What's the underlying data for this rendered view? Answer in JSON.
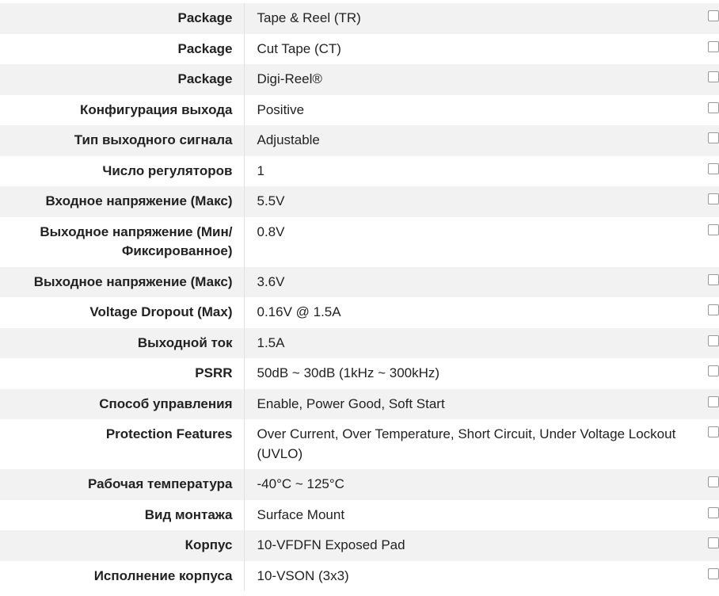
{
  "specs": [
    {
      "attribute": "Package",
      "value": "Tape & Reel (TR)"
    },
    {
      "attribute": "Package",
      "value": "Cut Tape (CT)"
    },
    {
      "attribute": "Package",
      "value": "Digi-Reel®"
    },
    {
      "attribute": "Конфигурация выхода",
      "value": "Positive"
    },
    {
      "attribute": "Тип выходного сигнала",
      "value": "Adjustable"
    },
    {
      "attribute": "Число регуляторов",
      "value": "1"
    },
    {
      "attribute": "Входное напряжение (Макс)",
      "value": "5.5V"
    },
    {
      "attribute": "Выходное напряжение (Мин/Фиксированное)",
      "value": "0.8V"
    },
    {
      "attribute": "Выходное напряжение (Макс)",
      "value": "3.6V"
    },
    {
      "attribute": "Voltage Dropout (Max)",
      "value": "0.16V @ 1.5A"
    },
    {
      "attribute": "Выходной ток",
      "value": "1.5A"
    },
    {
      "attribute": "PSRR",
      "value": "50dB ~ 30dB (1kHz ~ 300kHz)"
    },
    {
      "attribute": "Способ управления",
      "value": "Enable, Power Good, Soft Start"
    },
    {
      "attribute": "Protection Features",
      "value": "Over Current, Over Temperature, Short Circuit, Under Voltage Lockout (UVLO)"
    },
    {
      "attribute": "Рабочая температура",
      "value": "-40°C ~ 125°C"
    },
    {
      "attribute": "Вид монтажа",
      "value": "Surface Mount"
    },
    {
      "attribute": "Корпус",
      "value": "10-VFDFN Exposed Pad"
    },
    {
      "attribute": "Исполнение корпуса",
      "value": "10-VSON (3x3)"
    }
  ]
}
